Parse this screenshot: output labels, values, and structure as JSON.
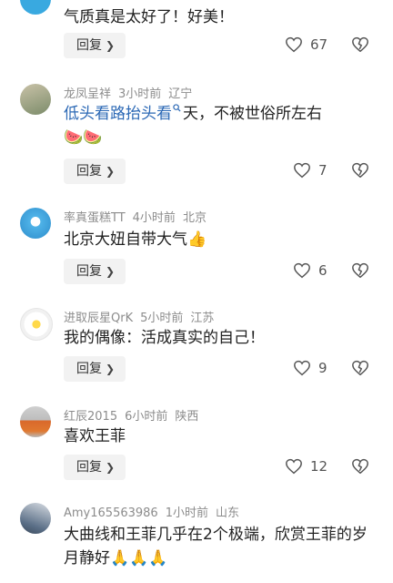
{
  "comments": [
    {
      "username": "",
      "time": "",
      "location": "",
      "text": "气质真是太好了！好美！",
      "reply_label": "回复",
      "likes": "67"
    },
    {
      "username": "龙凤呈祥",
      "time": "3小时前",
      "location": "辽宁",
      "text_link": "低头看路抬头看",
      "text": "天，不被世俗所左右",
      "emoji": "🍉🍉",
      "reply_label": "回复",
      "likes": "7"
    },
    {
      "username": "率真蛋糕TT",
      "time": "4小时前",
      "location": "北京",
      "text": "北京大妞自带大气",
      "emoji": "👍",
      "reply_label": "回复",
      "likes": "6"
    },
    {
      "username": "进取辰星QrK",
      "time": "5小时前",
      "location": "江苏",
      "text": "我的偶像：活成真实的自己！",
      "reply_label": "回复",
      "likes": "9"
    },
    {
      "username": "红辰2015",
      "time": "6小时前",
      "location": "陕西",
      "text": "喜欢王菲",
      "reply_label": "回复",
      "likes": "12"
    },
    {
      "username": "Amy165563986",
      "time": "1小时前",
      "location": "山东",
      "text": "大曲线和王菲几乎在2个极端，欣赏王菲的岁月静好",
      "emoji": "🙏🙏🙏",
      "reply_label": "回复",
      "likes": ""
    }
  ],
  "icons": {
    "like": "heart-outline-icon",
    "dislike": "broken-heart-icon",
    "reply_chevron": "chevron-right-icon",
    "search": "search-icon"
  }
}
